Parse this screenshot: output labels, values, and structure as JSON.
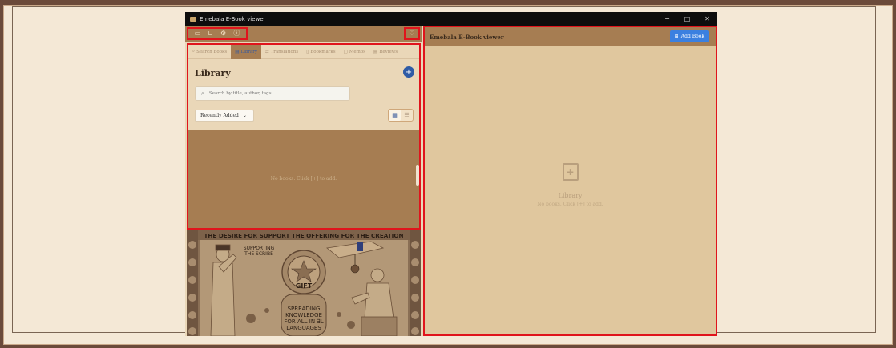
{
  "window": {
    "title": "Emebala E-Book viewer",
    "controls": [
      "−",
      "□",
      "✕"
    ]
  },
  "toolbar": {
    "icons": [
      "library-icon",
      "folder-icon",
      "settings-icon",
      "info-icon"
    ],
    "right_icon": "heart-icon"
  },
  "tabs": [
    {
      "label": "Search Books",
      "icon": "search-icon",
      "active": false
    },
    {
      "label": "Library",
      "icon": "library-icon",
      "active": true
    },
    {
      "label": "Translations",
      "icon": "translate-icon",
      "active": false
    },
    {
      "label": "Bookmarks",
      "icon": "bookmark-icon",
      "active": false
    },
    {
      "label": "Memos",
      "icon": "memo-icon",
      "active": false
    },
    {
      "label": "Reviews",
      "icon": "review-icon",
      "active": false
    }
  ],
  "library": {
    "heading": "Library",
    "add_label": "+",
    "search_placeholder": "Search by title, author, tags...",
    "sort_selected": "Recently Added",
    "empty_message": "No books. Click [+] to add."
  },
  "right_panel": {
    "title": "Emebala E-Book viewer",
    "add_book_label": "Add Book",
    "placeholder_title": "Library",
    "placeholder_message": "No books. Click [+] to add."
  },
  "banner": {
    "line1": "THE DESIRE FOR SUPPORT THE OFFERING FOR THE CREATION",
    "supporting": [
      "SUPPORTING",
      "THE SCRIBE"
    ],
    "gift": "GIFT",
    "spreading": [
      "SPREADING",
      "KNOWLEDGE",
      "FOR ALL IN ∃L",
      "LANGUAGES"
    ]
  },
  "colors": {
    "accent": "#a67d52",
    "highlight": "#e0141c",
    "primary_button": "#3b80e0"
  }
}
